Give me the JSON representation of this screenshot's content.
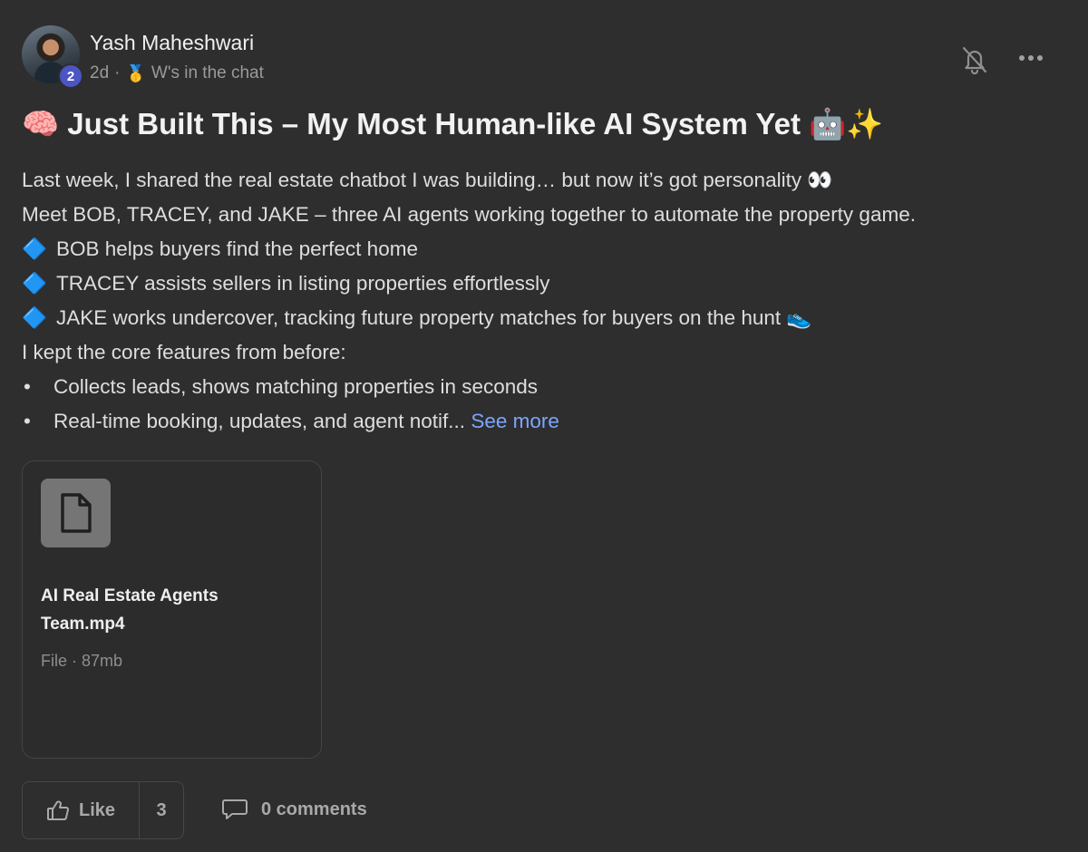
{
  "author": {
    "name": "Yash Maheshwari",
    "level": "2",
    "time": "2d",
    "separator": "·",
    "medal": "🥇",
    "category": "W's in the chat"
  },
  "post": {
    "title_emoji": "🧠",
    "title_text": "Just Built This – My Most Human-like AI System Yet",
    "title_trailing": "🤖✨",
    "lines": [
      {
        "text": "Last week, I shared the real estate chatbot I was building… but now it’s got personality 👀"
      },
      {
        "text": "Meet BOB, TRACEY, and JAKE – three AI agents working together to automate the property game."
      },
      {
        "marker": "🔷",
        "text": "BOB helps buyers find the perfect home"
      },
      {
        "marker": "🔷",
        "text": "TRACEY assists sellers in listing properties effortlessly"
      },
      {
        "marker": "🔷",
        "text": "JAKE works undercover, tracking future property matches for buyers on the hunt 👟"
      },
      {
        "text": "I kept the core features from before:"
      },
      {
        "bullet": "•",
        "text": "Collects leads, shows matching properties in seconds"
      },
      {
        "bullet": "•",
        "text": "Real-time booking, updates, and agent notif...",
        "link": "See more"
      }
    ]
  },
  "attachment": {
    "icon": "document-icon",
    "name_line1": "AI Real Estate Agents",
    "name_line2": "Team.mp4",
    "meta": "File · 87mb"
  },
  "footer": {
    "like_label": "Like",
    "like_count": "3",
    "comments_label": "0 comments"
  },
  "icons": {
    "bell": "bell-icon",
    "more": "more-icon",
    "like": "thumbs-up-icon",
    "comment": "comment-icon"
  },
  "colors": {
    "background": "#2e2e2e",
    "link": "#7da6ff",
    "level_badge": "#4b55c4"
  }
}
